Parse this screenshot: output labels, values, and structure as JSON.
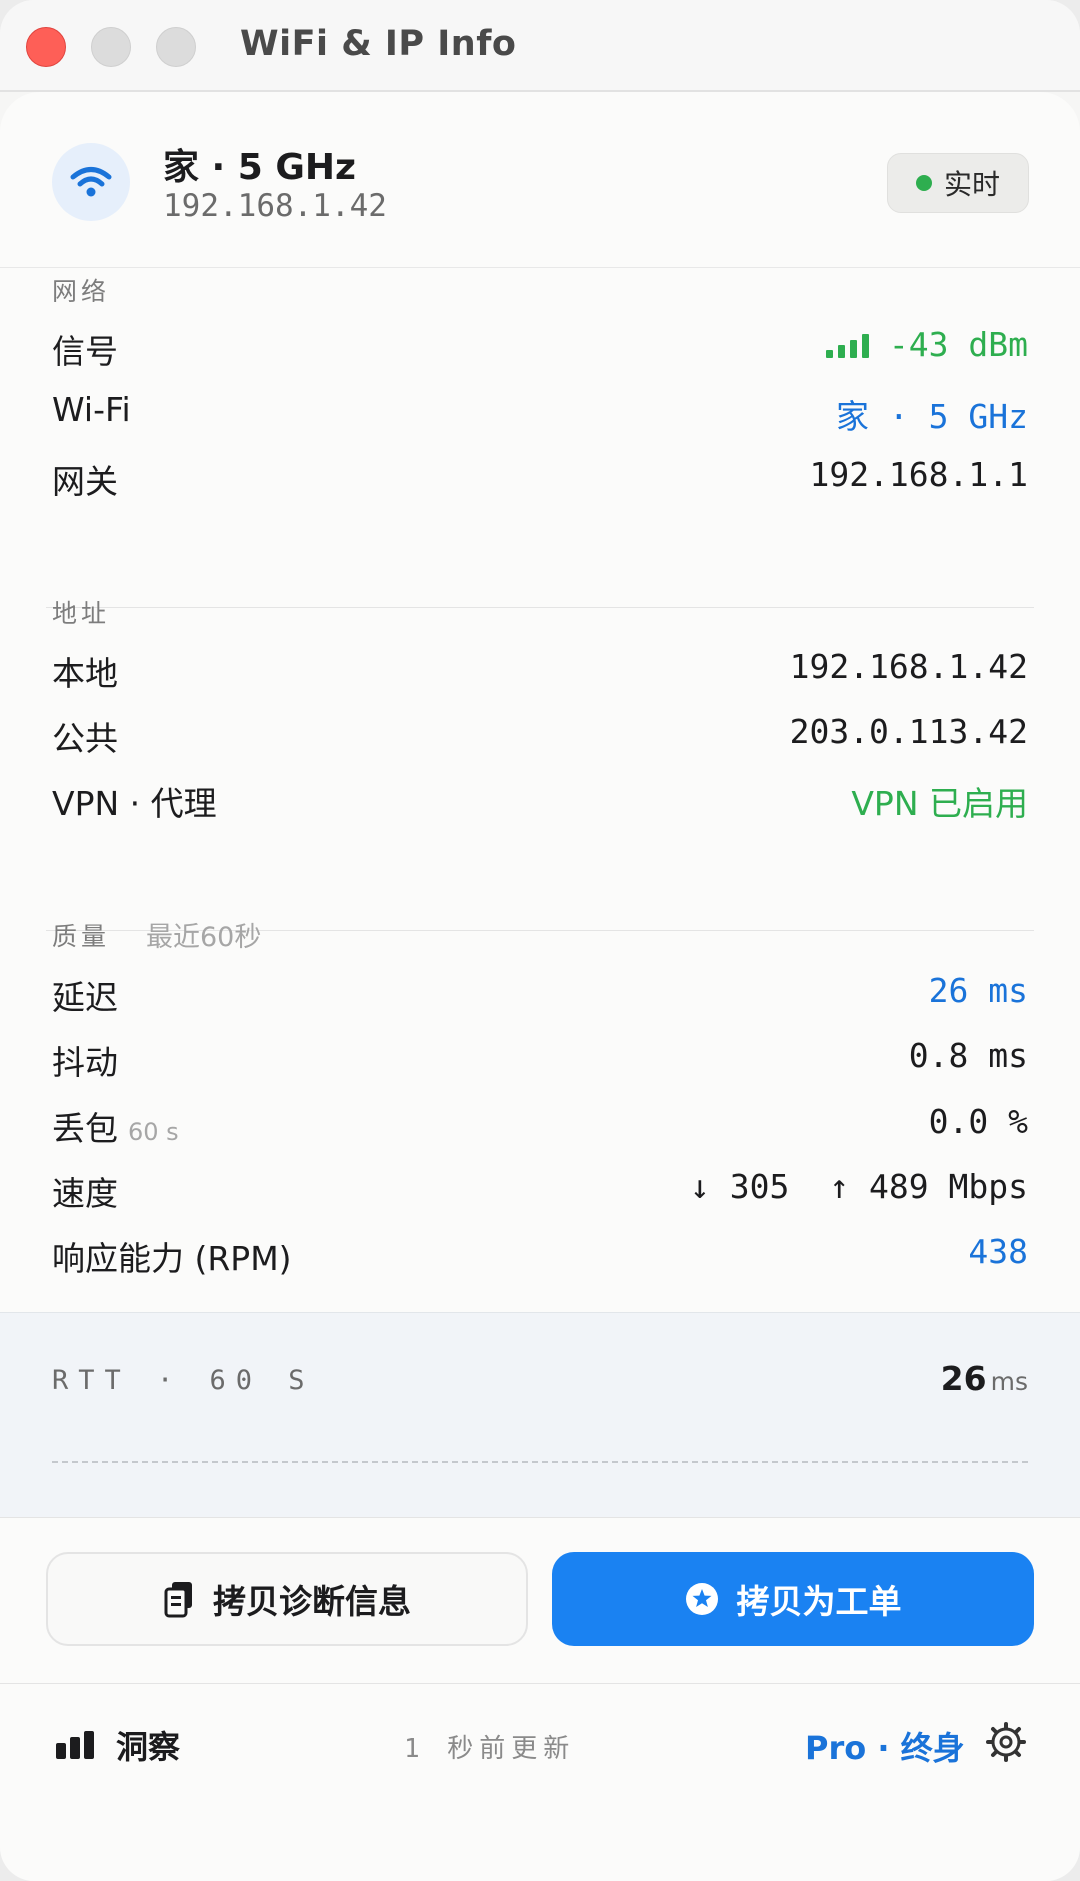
{
  "window": {
    "title": "WiFi & IP Info"
  },
  "header": {
    "network_name": "家 · 5 GHz",
    "ip": "192.168.1.42",
    "status_label": "实时",
    "status_color": "#2eae4f"
  },
  "network": {
    "section_label": "网络",
    "rows": [
      {
        "label": "信号",
        "value": "-43 dBm",
        "icon": "signal-bars-icon",
        "color": "#2eae4f"
      },
      {
        "label": "Wi-Fi",
        "value": "家 · 5 GHz",
        "color": "#1a73d9"
      },
      {
        "label": "网关",
        "value": "192.168.1.1"
      }
    ]
  },
  "address": {
    "section_label": "地址",
    "rows": [
      {
        "label": "本地",
        "value": "192.168.1.42"
      },
      {
        "label": "公共",
        "value": "203.0.113.42"
      },
      {
        "label": "VPN · 代理",
        "value": "VPN 已启用",
        "color": "#2eae4f"
      }
    ]
  },
  "quality": {
    "section_label": "质量",
    "window_label": "最近60秒",
    "rows": [
      {
        "label": "延迟",
        "value": "26 ms",
        "color": "#1a73d9"
      },
      {
        "label": "抖动",
        "value": "0.8 ms"
      },
      {
        "label": "丢包",
        "sublabel": "60 s",
        "value": "0.0 %"
      },
      {
        "label": "速度",
        "download": "↓ 305",
        "upload": "↑ 489 Mbps"
      },
      {
        "label": "响应能力 (RPM)",
        "value": "438",
        "color": "#1a73d9"
      }
    ]
  },
  "rtt": {
    "label": "RTT · 60 S",
    "value": "26",
    "unit": "ms"
  },
  "actions": {
    "copy_diagnostics": "拷贝诊断信息",
    "copy_ticket": "拷贝为工单",
    "accent_color": "#1a82f2"
  },
  "footer": {
    "insight_label": "洞察",
    "updated_text": "1 秒前更新",
    "plan_label": "Pro · 终身"
  }
}
